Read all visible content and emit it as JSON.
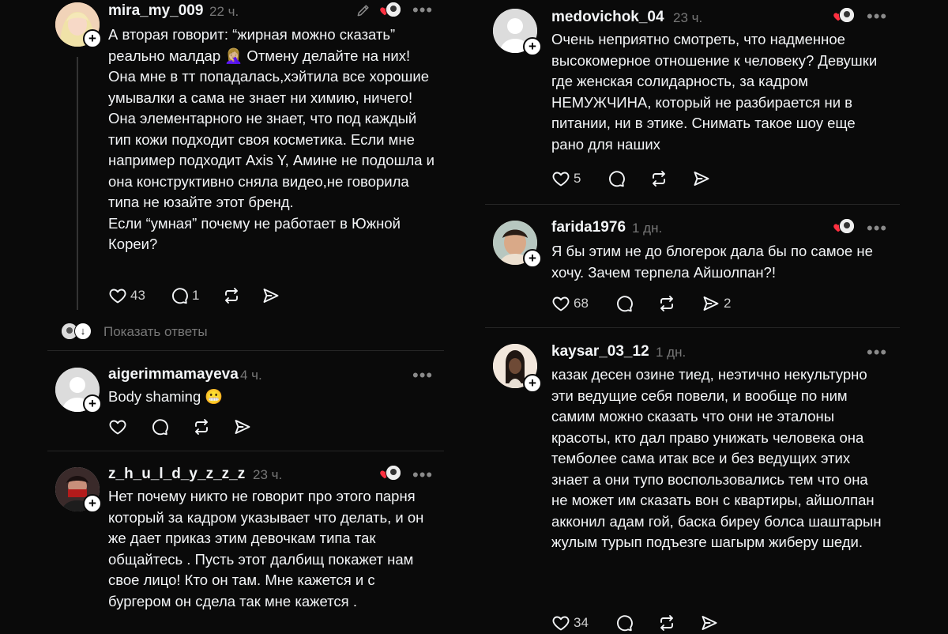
{
  "left_column": {
    "posts": [
      {
        "username": "mira_my_009",
        "time": "22 ч.",
        "text": "А вторая говорит: “жирная можно сказать” реально малдар 🤦🏼‍♀️ Отмену делайте на них!\nОна мне в тт попадалась,хэйтила все хорошие умывалки а сама не знает ни химию, ничего! Она элементарного не знает, что под каждый тип кожи подходит своя косметика. Если мне например подходит Axis Y, Амине не подошла и она конструктивно сняла видео,не говорила типа не юзайте этот бренд.\nЕсли “умная” почему не работает в Южной Кореи?",
        "likes": "43",
        "replies": "1",
        "show_replies": "Показать ответы"
      },
      {
        "username": "aigerimmamayeva",
        "time": "4 ч.",
        "text": "Body shaming 😬"
      },
      {
        "username": "z_h_u_l_d_y_z_z_z",
        "time": "23 ч.",
        "text": "Нет почему никто не говорит про этого парня который за кадром указывает что делать, и он же дает приказ этим девочкам типа так общайтесь . Пусть этот далбищ покажет нам свое лицо! Кто он там. Мне кажется и с бургером он сдела так мне кажется ."
      }
    ]
  },
  "right_column": {
    "posts": [
      {
        "username": "medovichok_04",
        "time": "23 ч.",
        "text": "Очень неприятно смотреть, что надменное высокомерное отношение к человеку? Девушки где женская солидарность, за кадром НЕМУЖЧИНА, который не разбирается ни в питании, ни в этике. Снимать такое шоу еще рано для наших",
        "likes": "5"
      },
      {
        "username": "farida1976",
        "time": "1 дн.",
        "text": "Я бы этим не до блогерок дала бы по самое не хочу. Зачем терпела Айшолпан?!",
        "likes": "68",
        "shares": "2"
      },
      {
        "username": "kaysar_03_12",
        "time": "1 дн.",
        "text": "казак десен озине тиед, неэтично некультурно эти ведущие себя повели, и вообще по ним самим можно сказать что они не эталоны красоты, кто дал право унижать человека она темболее сама итак все и без ведущих этих знает а они тупо воспользовались тем что она не может им сказать вон с квартиры, айшолпан акконил адам гой, баска биреу болса шаштарын жулым турып подъезге шагырм жиберу шеди.",
        "likes": "34"
      }
    ]
  },
  "colors": {
    "background": "#0a0a0a",
    "text": "#f3f5f7",
    "muted": "#777777",
    "heart": "#ff3040"
  }
}
